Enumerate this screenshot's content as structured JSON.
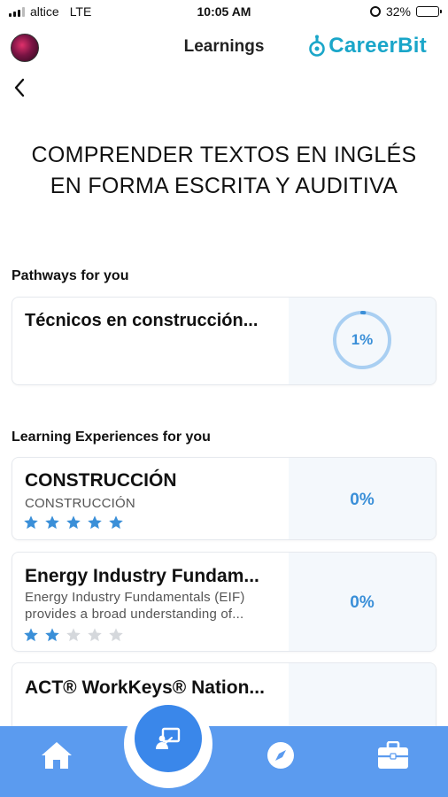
{
  "status_bar": {
    "carrier": "altice",
    "network": "LTE",
    "time": "10:05 AM",
    "battery": "32%"
  },
  "header": {
    "title": "Learnings",
    "brand": "CareerBit"
  },
  "course": {
    "title_line1": "COMPRENDER TEXTOS EN INGLÉS",
    "title_line2": "EN FORMA ESCRITA Y AUDITIVA"
  },
  "pathways": {
    "label": "Pathways for you",
    "items": [
      {
        "title": "Técnicos en construcción...",
        "progress_label": "1%",
        "progress": 0.01
      }
    ]
  },
  "experiences": {
    "label": "Learning Experiences for you",
    "items": [
      {
        "title": "CONSTRUCCIÓN",
        "subtitle": "CONSTRUCCIÓN",
        "rating": 5,
        "progress_label": "0%"
      },
      {
        "title": "Energy Industry Fundam...",
        "subtitle_line1": "Energy Industry Fundamentals (EIF)",
        "subtitle_line2": "provides a broad understanding of...",
        "rating": 2,
        "progress_label": "0%"
      },
      {
        "title": "ACT® WorkKeys® Nation..."
      }
    ]
  },
  "colors": {
    "accent": "#3a8fd8",
    "tabbar": "#5b9bef",
    "star_on": "#3a8fd8",
    "star_off": "#d5d8dc",
    "brand": "#1aa6c9"
  },
  "tabbar": {
    "items": [
      "home-icon",
      "learnings-icon",
      "compass-icon",
      "briefcase-icon"
    ]
  }
}
